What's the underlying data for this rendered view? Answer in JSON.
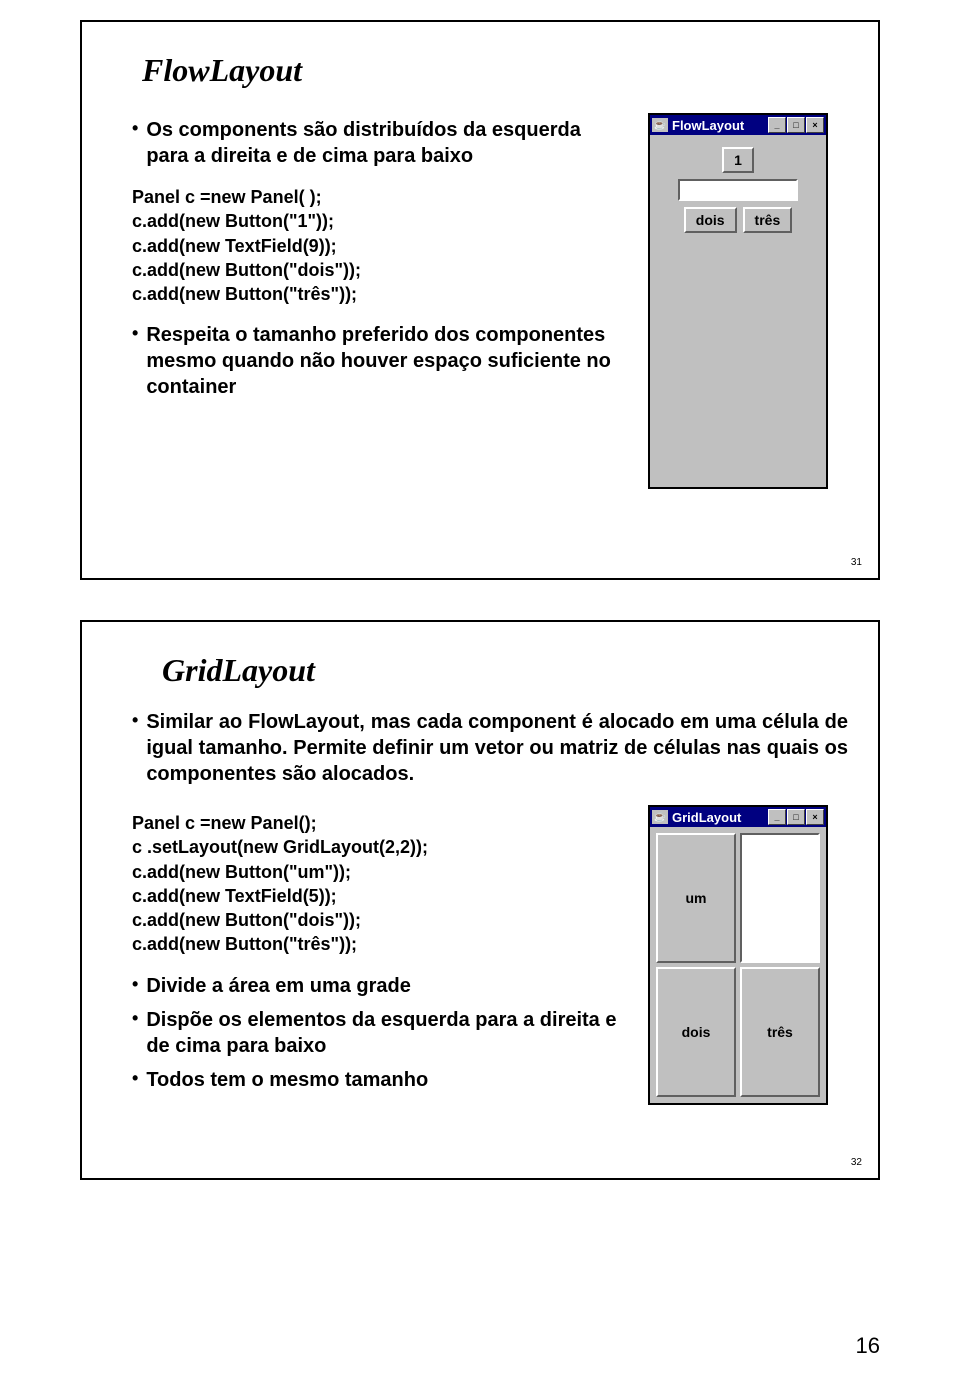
{
  "page_number": "16",
  "slide1": {
    "number": "31",
    "title": "FlowLayout",
    "bullet1": "Os components são distribuídos da esquerda para a direita e de cima para baixo",
    "code": [
      "Panel c =new Panel( );",
      "c.add(new Button(\"1\"));",
      "c.add(new TextField(9));",
      "c.add(new Button(\"dois\"));",
      "c.add(new Button(\"três\"));"
    ],
    "bullet2": "Respeita o tamanho preferido dos componentes mesmo quando não houver espaço suficiente no container",
    "window": {
      "title": "FlowLayout",
      "btn1": "1",
      "btn_dois": "dois",
      "btn_tres": "três"
    }
  },
  "slide2": {
    "number": "32",
    "title": "GridLayout",
    "bullet1": "Similar ao FlowLayout, mas cada component é alocado em uma célula de igual tamanho. Permite definir um vetor ou matriz de células nas quais os componentes são alocados.",
    "code": [
      "Panel c =new Panel();",
      "c .setLayout(new GridLayout(2,2));",
      "c.add(new Button(\"um\"));",
      "c.add(new TextField(5));",
      "c.add(new Button(\"dois\"));",
      "c.add(new Button(\"três\"));"
    ],
    "bullet2": "Divide a área em uma grade",
    "bullet3": "Dispõe os elementos da esquerda para a direita e de cima para baixo",
    "bullet4": "Todos tem o mesmo tamanho",
    "window": {
      "title": "GridLayout",
      "cell_um": "um",
      "cell_dois": "dois",
      "cell_tres": "três"
    }
  }
}
